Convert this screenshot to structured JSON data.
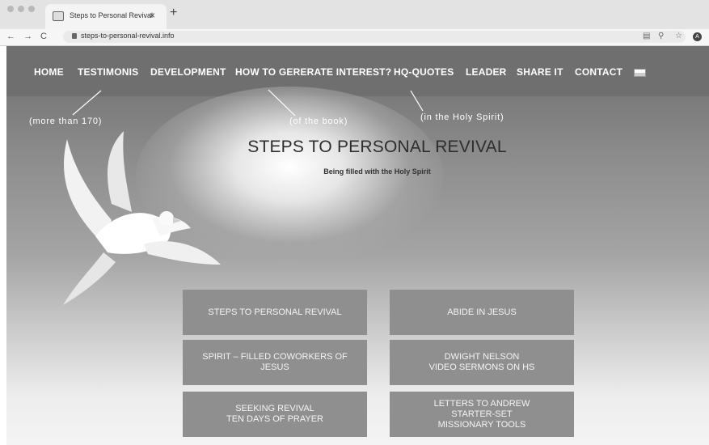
{
  "browser": {
    "tab_title": "Steps to Personal Revival",
    "tab_close": "×",
    "new_tab": "+",
    "url": "steps-to-personal-revival.info",
    "profile_initial": "A"
  },
  "nav": {
    "items": [
      "HOME",
      "TESTIMONIS",
      "DEVELOPMENT",
      "HOW TO GERERATE INTEREST?",
      "HQ-QUOTES",
      "LEADER",
      "SHARE IT",
      "CONTACT"
    ]
  },
  "annotations": {
    "testimonis": "(more than 170)",
    "interest": "(of the book)",
    "quotes": "(in the Holy Spirit)"
  },
  "hero": {
    "title": "STEPS TO PERSONAL REVIVAL",
    "subtitle": "Being filled with the Holy Spirit"
  },
  "buttons": [
    "STEPS TO PERSONAL REVIVAL",
    "ABIDE IN JESUS",
    "SPIRIT – FILLED COWORKERS OF\nJESUS",
    "DWIGHT NELSON\nVIDEO SERMONS ON HS",
    "SEEKING REVIVAL\nTEN DAYS OF PRAYER",
    "LETTERS TO ANDREW\nSTARTER-SET\nMISSIONARY TOOLS"
  ]
}
